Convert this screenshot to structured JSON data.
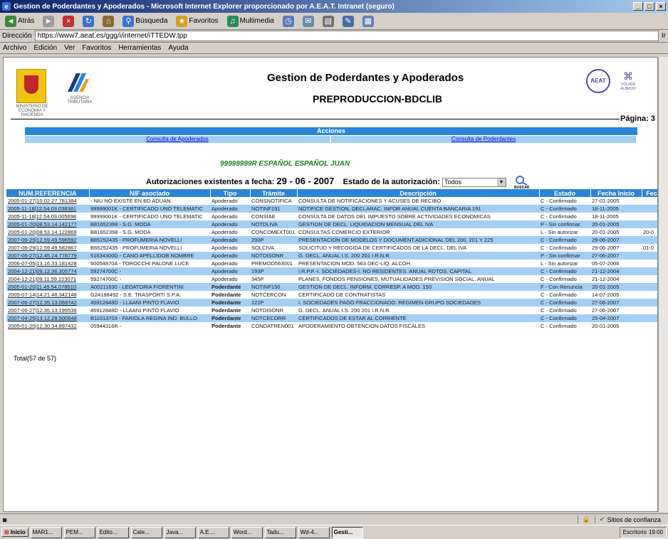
{
  "window": {
    "title": "Gestion de Poderdantes y Apoderados - Microsoft Internet Explorer proporcionado por A.E.A.T. Intranet (seguro)",
    "controls": [
      "_",
      "□",
      "×"
    ]
  },
  "toolbar": {
    "back": "Atrás",
    "search": "Búsqueda",
    "favorites": "Favoritos",
    "multimedia": "Multimedia"
  },
  "address": {
    "label": "Dirección",
    "url": "https://www7.aeat.es/ggg/i/internet/iTTEDW.tpp",
    "go": "Ir"
  },
  "menu": [
    "Archivo",
    "Edición",
    "Ver",
    "Favoritos",
    "Herramientas",
    "Ayuda"
  ],
  "header": {
    "title": "Gestion de Poderdantes y Apoderados",
    "subtitle": "PREPRODUCCION-BDCLIB",
    "agency_caption": "AGENCIA TRIBUTARIA",
    "ministry_caption": "MINISTERIO DE ECONOMIA Y HACIENDA",
    "volver": "VOLVER ALINICIO",
    "pagina": "Página: 3"
  },
  "acciones": {
    "title": "Acciones",
    "link_apoderados": "Consulta de Apoderados",
    "link_poderdantes": "Consulta de Poderdantes"
  },
  "person": "99999999R ESPAÑOL ESPAÑOL JUAN",
  "autorizaciones": {
    "label": "Autorizaciones existentes a fecha:",
    "fecha": "29 - 06 - 2007",
    "estado_label": "Estado de la autorización:",
    "estado_value": "Todos",
    "buscar": "BUSCAR"
  },
  "table": {
    "headers": [
      "NUM.REFERENCIA",
      "NIF asociado",
      "Tipo",
      "Trámite",
      "Descripción",
      "Estado",
      "Fecha Inicio",
      "Fec"
    ],
    "rows": [
      [
        "2005-01-27|10.02.27.781384",
        "- NIU NO EXISTE EN BD ADUAN.",
        "Apoderado",
        "CONSNOTIFICA",
        "CONSULTA DE NOTIFICACIONES Y ACUSES DE RECIBO",
        "C - Confirmado",
        "27-01-2005",
        ""
      ],
      [
        "2005-11-18|12.54.03.038381",
        "99999001K - CERTIFICADO UNO TELEMATIC",
        "Apoderado",
        "NOTINF191",
        "NOTIFICE GESTION, DECLARAC. INFOR ANUAL CUENTA BANCARIA 191",
        "C - Confirmado",
        "18-11-2005",
        ""
      ],
      [
        "2005-11-18|12.54.03.005698",
        "99999001K - CERTIFICADO UNO TELEMATIC",
        "Apoderado",
        "CONSIAE",
        "CONSULTA DE DATOS DEL IMPUESTO SOBRE ACTIVIDADES ECONOMICAS",
        "C - Confirmado",
        "18-11-2005",
        ""
      ],
      [
        "2005-01-20|08.53.14.142177",
        "B81652398 - S.G. MODA",
        "Apoderado",
        "NOTDLIVA",
        "GESTION DE DECL. LIQUIDACION MENSUAL DEL IVA",
        "P - Sin confirmar",
        "20-01-2005",
        ""
      ],
      [
        "2005-01-20|08.53.14.122869",
        "B81652398 - S.G. MODA",
        "Apoderado",
        "CONCOMEXT001",
        "CONSULTAS COMERCIO EXTERIOR",
        "L - Sin autorizar",
        "20-01-2005",
        "20-0"
      ],
      [
        "2007-06-29|12.59.49.596592",
        "B85252435 - PROFUMERIA NOVELLI",
        "Apoderado",
        "200P",
        "PRESENTACION DE MODELOS Y DOCUMENT.ADICIONAL DEL 200, 201 Y 225",
        "C - Confirmado",
        "29-06-2007",
        ""
      ],
      [
        "2007-06-29|12.59.49.582867",
        "B65252435 - PROFUMERIA NOVELLI",
        "Apoderado",
        "SOLCIVA",
        "SOLICITUD Y RECOGIDA DE CERTIFICADOS DE LA DECL. DEL IVA",
        "C - Confirmado",
        "29-06-2007",
        "01-0"
      ],
      [
        "2007-06-27|12.45.24.778779",
        "51634300D - CANO APELLIDOB NOMBRE",
        "Apoderado",
        "NOTDISONR",
        "G. DECL. ANUAL I.S. 200 201 I.R.N.R.",
        "P - Sin confirmar",
        "27-06-2007",
        ""
      ],
      [
        "2006-07-05|13.16.33.181428",
        "50054870A - TOROCCHI PALONE LUCE",
        "Apoderado",
        "PREMOD563001",
        "PRESENTACION MOD. 563 DEC-LIQ. ALCOH.",
        "L - Sin autorizar",
        "05-07-2006",
        ""
      ],
      [
        "2004-12-21|09.12.36.305774",
        "59274700C -",
        "Apoderado",
        "193P",
        "I.R.P.F.-I. SOCIEDADES-I. NO RESIDENTES. ANUAL RDTOS. CAPITAL",
        "C - Confirmado",
        "21-12-2004",
        ""
      ],
      [
        "2004-12-21|09.11.59.223071",
        "59274700C -",
        "Apoderado",
        "345P",
        "PLANES, FONDOS PENSIONES, MUTUALIDADES PREVISION SOCIAL. ANUAL",
        "C - Confirmado",
        "21-12-2004",
        ""
      ],
      [
        "2005-01-20|11.45.54.078510",
        "A00211830 - LEOATORIA FIORENTINI",
        "Poderdante",
        "NOTINF150",
        "GESTION DE DECL. INFORM. CORRESP. A MOD. 150",
        "F - Con Renuncia",
        "20-01-2005",
        ""
      ],
      [
        "2005-07-14|14.21.48.342148",
        "G24188492 - S.E. TRASPORTI S.P.A.",
        "Poderdante",
        "NOTCERCON",
        "CERTIFICADO DE CONTRATISTAS",
        "C - Confirmado",
        "14-07-2005",
        ""
      ],
      [
        "2007-06-27|12.35.13.069742",
        "46912848D - LLAANI PINTO FLAVIO",
        "Poderdante",
        "222P",
        "I. SOCIEDADES PAGO FRACCIONADO. REGIMEN GRUPO SOCIEDADES",
        "C - Confirmado",
        "27-06-2007",
        ""
      ],
      [
        "2007-06-27|12.35.13.199536",
        "46912848D - LLAANI PINTO FLAVIO",
        "Poderdante",
        "NOTDISONR",
        "G. DECL. ANUAL I.S. 200 201 I.R.N.R.",
        "C - Confirmado",
        "27-06-2007",
        ""
      ],
      [
        "2007-04-25|13.12.28.500648",
        "B11013703 - FARIOLA REGINA IND. BULLO",
        "Poderdante",
        "NOTCECORR",
        "CERTIFICADOS DE ESTAR AL CORRIENTE",
        "C - Confirmado",
        "25-04-2007",
        ""
      ],
      [
        "2005-01-20|12.30.34.897432",
        "05944316R -",
        "Poderdante",
        "CONDATREN001",
        "APODERAMIENTO OBTENCION DATOS FISCALES",
        "C - Confirmado",
        "20-01-2005",
        ""
      ]
    ]
  },
  "total": "Total(57 de 57)",
  "statusbar": {
    "zone": "Sitios de confianza"
  },
  "taskbar": {
    "start": "Inicio",
    "tasks": [
      "MAR1...",
      "PEM...",
      "Edito...",
      "Cale...",
      "Java...",
      "A.E....",
      "Word...",
      "Tadu...",
      "Wd-4...",
      "Gesti..."
    ],
    "tray_label": "Escritorio",
    "clock": "19:00"
  },
  "colors": {
    "header_blue": "#2a85d8",
    "row_alt": "#a4cff5",
    "link": "#0000ff",
    "person_green": "#208020"
  }
}
